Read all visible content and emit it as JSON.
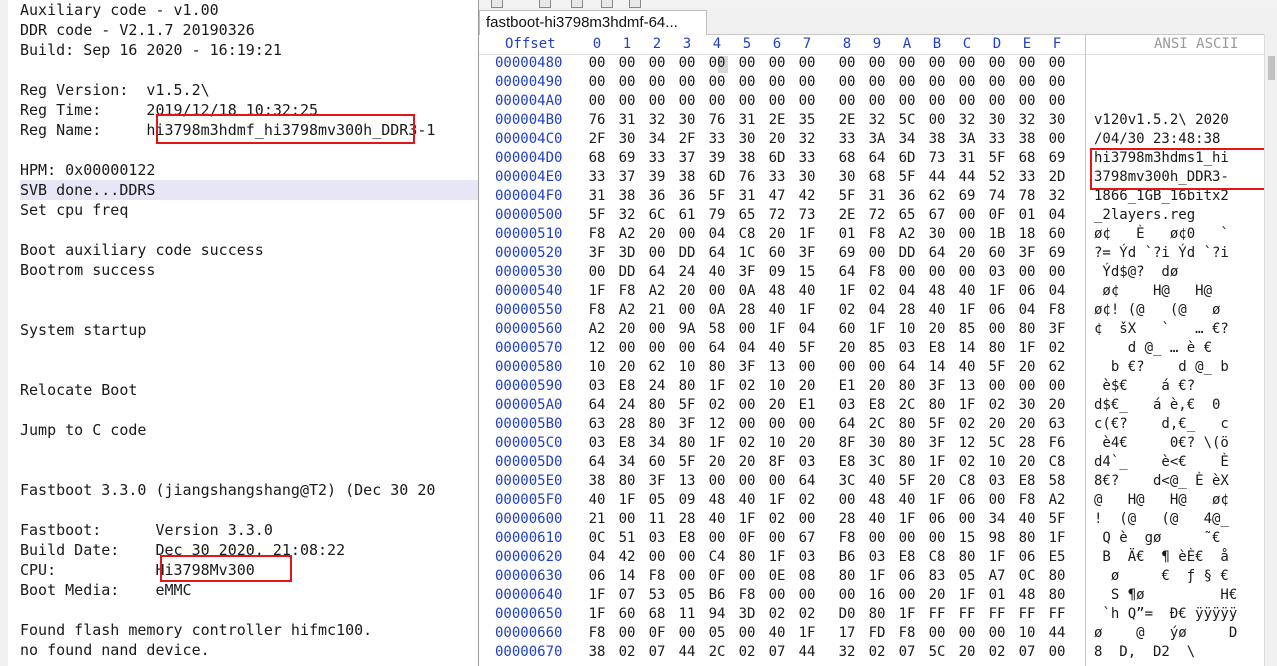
{
  "log": {
    "lines": [
      "Auxiliary code - v1.00",
      "DDR code - V2.1.7 20190326",
      "Build: Sep 16 2020 - 16:19:21",
      "",
      "Reg Version:  v1.5.2\\",
      "Reg Time:     2019/12/18 10:32:25",
      "Reg Name:     hi3798m3hdmf_hi3798mv300h_DDR3-1",
      "",
      "HPM: 0x00000122",
      "SVB done...DDRS",
      "Set cpu freq",
      "",
      "Boot auxiliary code success",
      "Bootrom success",
      "",
      "",
      "System startup",
      "",
      "",
      "Relocate Boot",
      "",
      "Jump to C code",
      "",
      "",
      "Fastboot 3.3.0 (jiangshangshang@T2) (Dec 30 20",
      "",
      "Fastboot:      Version 3.3.0",
      "Build Date:    Dec 30 2020, 21:08:22",
      "CPU:           Hi3798Mv300",
      "Boot Media:    eMMC",
      "",
      "Found flash memory controller hifmc100.",
      "no found nand device."
    ],
    "highlighted_line_index": 9
  },
  "hex_editor": {
    "tab_title": "fastboot-hi3798m3hdmf-64...",
    "header": {
      "offset_label": "Offset",
      "columns": [
        "0",
        "1",
        "2",
        "3",
        "4",
        "5",
        "6",
        "7",
        "8",
        "9",
        "A",
        "B",
        "C",
        "D",
        "E",
        "F"
      ],
      "ansi_label": "ANSI ASCII"
    },
    "rows": [
      {
        "offset": "00000480",
        "bytes": [
          "00",
          "00",
          "00",
          "00",
          "00",
          "00",
          "00",
          "00",
          "00",
          "00",
          "00",
          "00",
          "00",
          "00",
          "00",
          "00"
        ],
        "ascii": ""
      },
      {
        "offset": "00000490",
        "bytes": [
          "00",
          "00",
          "00",
          "00",
          "00",
          "00",
          "00",
          "00",
          "00",
          "00",
          "00",
          "00",
          "00",
          "00",
          "00",
          "00"
        ],
        "ascii": ""
      },
      {
        "offset": "000004A0",
        "bytes": [
          "00",
          "00",
          "00",
          "00",
          "00",
          "00",
          "00",
          "00",
          "00",
          "00",
          "00",
          "00",
          "00",
          "00",
          "00",
          "00"
        ],
        "ascii": ""
      },
      {
        "offset": "000004B0",
        "bytes": [
          "76",
          "31",
          "32",
          "30",
          "76",
          "31",
          "2E",
          "35",
          "2E",
          "32",
          "5C",
          "00",
          "32",
          "30",
          "32",
          "30"
        ],
        "ascii": "v120v1.5.2\\ 2020"
      },
      {
        "offset": "000004C0",
        "bytes": [
          "2F",
          "30",
          "34",
          "2F",
          "33",
          "30",
          "20",
          "32",
          "33",
          "3A",
          "34",
          "38",
          "3A",
          "33",
          "38",
          "00"
        ],
        "ascii": "/04/30 23:48:38"
      },
      {
        "offset": "000004D0",
        "bytes": [
          "68",
          "69",
          "33",
          "37",
          "39",
          "38",
          "6D",
          "33",
          "68",
          "64",
          "6D",
          "73",
          "31",
          "5F",
          "68",
          "69"
        ],
        "ascii": "hi3798m3hdms1_hi"
      },
      {
        "offset": "000004E0",
        "bytes": [
          "33",
          "37",
          "39",
          "38",
          "6D",
          "76",
          "33",
          "30",
          "30",
          "68",
          "5F",
          "44",
          "44",
          "52",
          "33",
          "2D"
        ],
        "ascii": "3798mv300h_DDR3-"
      },
      {
        "offset": "000004F0",
        "bytes": [
          "31",
          "38",
          "36",
          "36",
          "5F",
          "31",
          "47",
          "42",
          "5F",
          "31",
          "36",
          "62",
          "69",
          "74",
          "78",
          "32"
        ],
        "ascii": "1866_1GB_16bitx2"
      },
      {
        "offset": "00000500",
        "bytes": [
          "5F",
          "32",
          "6C",
          "61",
          "79",
          "65",
          "72",
          "73",
          "2E",
          "72",
          "65",
          "67",
          "00",
          "0F",
          "01",
          "04"
        ],
        "ascii": "_2layers.reg"
      },
      {
        "offset": "00000510",
        "bytes": [
          "F8",
          "A2",
          "20",
          "00",
          "04",
          "C8",
          "20",
          "1F",
          "01",
          "F8",
          "A2",
          "30",
          "00",
          "1B",
          "18",
          "60"
        ],
        "ascii": "ø¢   È   ø¢0   `"
      },
      {
        "offset": "00000520",
        "bytes": [
          "3F",
          "3D",
          "00",
          "DD",
          "64",
          "1C",
          "60",
          "3F",
          "69",
          "00",
          "DD",
          "64",
          "20",
          "60",
          "3F",
          "69"
        ],
        "ascii": "?= Ýd `?i Ýd `?i"
      },
      {
        "offset": "00000530",
        "bytes": [
          "00",
          "DD",
          "64",
          "24",
          "40",
          "3F",
          "09",
          "15",
          "64",
          "F8",
          "00",
          "00",
          "00",
          "03",
          "00",
          "00"
        ],
        "ascii": " Ýd$@?  dø"
      },
      {
        "offset": "00000540",
        "bytes": [
          "1F",
          "F8",
          "A2",
          "20",
          "00",
          "0A",
          "48",
          "40",
          "1F",
          "02",
          "04",
          "48",
          "40",
          "1F",
          "06",
          "04"
        ],
        "ascii": " ø¢    H@   H@"
      },
      {
        "offset": "00000550",
        "bytes": [
          "F8",
          "A2",
          "21",
          "00",
          "0A",
          "28",
          "40",
          "1F",
          "02",
          "04",
          "28",
          "40",
          "1F",
          "06",
          "04",
          "F8"
        ],
        "ascii": "ø¢! (@   (@   ø"
      },
      {
        "offset": "00000560",
        "bytes": [
          "A2",
          "20",
          "00",
          "9A",
          "58",
          "00",
          "1F",
          "04",
          "60",
          "1F",
          "10",
          "20",
          "85",
          "00",
          "80",
          "3F"
        ],
        "ascii": "¢  šX   `   … €?"
      },
      {
        "offset": "00000570",
        "bytes": [
          "12",
          "00",
          "00",
          "00",
          "64",
          "04",
          "40",
          "5F",
          "20",
          "85",
          "03",
          "E8",
          "14",
          "80",
          "1F",
          "02"
        ],
        "ascii": "    d @_ … è €"
      },
      {
        "offset": "00000580",
        "bytes": [
          "10",
          "20",
          "62",
          "10",
          "80",
          "3F",
          "13",
          "00",
          "00",
          "00",
          "64",
          "14",
          "40",
          "5F",
          "20",
          "62"
        ],
        "ascii": "  b €?    d @_ b"
      },
      {
        "offset": "00000590",
        "bytes": [
          "03",
          "E8",
          "24",
          "80",
          "1F",
          "02",
          "10",
          "20",
          "E1",
          "20",
          "80",
          "3F",
          "13",
          "00",
          "00",
          "00"
        ],
        "ascii": " è$€    á €?"
      },
      {
        "offset": "000005A0",
        "bytes": [
          "64",
          "24",
          "80",
          "5F",
          "02",
          "00",
          "20",
          "E1",
          "03",
          "E8",
          "2C",
          "80",
          "1F",
          "02",
          "30",
          "20"
        ],
        "ascii": "d$€_   á è,€  0"
      },
      {
        "offset": "000005B0",
        "bytes": [
          "63",
          "28",
          "80",
          "3F",
          "12",
          "00",
          "00",
          "00",
          "64",
          "2C",
          "80",
          "5F",
          "02",
          "20",
          "20",
          "63"
        ],
        "ascii": "c(€?    d,€_   c"
      },
      {
        "offset": "000005C0",
        "bytes": [
          "03",
          "E8",
          "34",
          "80",
          "1F",
          "02",
          "10",
          "20",
          "8F",
          "30",
          "80",
          "3F",
          "12",
          "5C",
          "28",
          "F6"
        ],
        "ascii": " è4€     0€? \\(ö"
      },
      {
        "offset": "000005D0",
        "bytes": [
          "64",
          "34",
          "60",
          "5F",
          "20",
          "20",
          "8F",
          "03",
          "E8",
          "3C",
          "80",
          "1F",
          "02",
          "10",
          "20",
          "C8"
        ],
        "ascii": "d4`_    è<€    È"
      },
      {
        "offset": "000005E0",
        "bytes": [
          "38",
          "80",
          "3F",
          "13",
          "00",
          "00",
          "00",
          "64",
          "3C",
          "40",
          "5F",
          "20",
          "C8",
          "03",
          "E8",
          "58"
        ],
        "ascii": "8€?    d<@_ È èX"
      },
      {
        "offset": "000005F0",
        "bytes": [
          "40",
          "1F",
          "05",
          "09",
          "48",
          "40",
          "1F",
          "02",
          "00",
          "48",
          "40",
          "1F",
          "06",
          "00",
          "F8",
          "A2"
        ],
        "ascii": "@   H@   H@   ø¢"
      },
      {
        "offset": "00000600",
        "bytes": [
          "21",
          "00",
          "11",
          "28",
          "40",
          "1F",
          "02",
          "00",
          "28",
          "40",
          "1F",
          "06",
          "00",
          "34",
          "40",
          "5F"
        ],
        "ascii": "!  (@   (@   4@_"
      },
      {
        "offset": "00000610",
        "bytes": [
          "0C",
          "51",
          "03",
          "E8",
          "00",
          "0F",
          "00",
          "67",
          "F8",
          "00",
          "00",
          "00",
          "15",
          "98",
          "80",
          "1F"
        ],
        "ascii": " Q è  gø     ˜€"
      },
      {
        "offset": "00000620",
        "bytes": [
          "04",
          "42",
          "00",
          "00",
          "C4",
          "80",
          "1F",
          "03",
          "B6",
          "03",
          "E8",
          "C8",
          "80",
          "1F",
          "06",
          "E5"
        ],
        "ascii": " B  Ä€  ¶ èÈ€  å"
      },
      {
        "offset": "00000630",
        "bytes": [
          "06",
          "14",
          "F8",
          "00",
          "0F",
          "00",
          "0E",
          "08",
          "80",
          "1F",
          "06",
          "83",
          "05",
          "A7",
          "0C",
          "80"
        ],
        "ascii": "  ø     €  ƒ § €"
      },
      {
        "offset": "00000640",
        "bytes": [
          "1F",
          "07",
          "53",
          "05",
          "B6",
          "F8",
          "00",
          "00",
          "00",
          "16",
          "00",
          "20",
          "1F",
          "01",
          "48",
          "80"
        ],
        "ascii": "  S ¶ø         H€"
      },
      {
        "offset": "00000650",
        "bytes": [
          "1F",
          "60",
          "68",
          "11",
          "94",
          "3D",
          "02",
          "02",
          "D0",
          "80",
          "1F",
          "FF",
          "FF",
          "FF",
          "FF",
          "FF"
        ],
        "ascii": " `h Q”=  Ð€ ÿÿÿÿÿ"
      },
      {
        "offset": "00000660",
        "bytes": [
          "F8",
          "00",
          "0F",
          "00",
          "05",
          "00",
          "40",
          "1F",
          "17",
          "FD",
          "F8",
          "00",
          "00",
          "00",
          "10",
          "44"
        ],
        "ascii": "ø    @   ýø     D"
      },
      {
        "offset": "00000670",
        "bytes": [
          "38",
          "02",
          "07",
          "44",
          "2C",
          "02",
          "07",
          "44",
          "32",
          "02",
          "07",
          "5C",
          "20",
          "02",
          "07",
          "00"
        ],
        "ascii": "8  D,  D2  \\"
      }
    ]
  },
  "annotation_color": "#e3141a"
}
